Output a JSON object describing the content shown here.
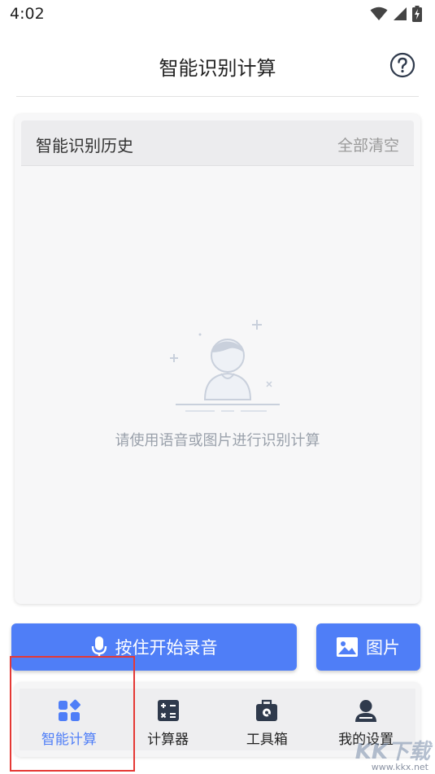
{
  "status_bar": {
    "time": "4:02",
    "icons": [
      "wifi-icon",
      "signal-icon",
      "battery-charging-icon"
    ]
  },
  "header": {
    "title": "智能识别计算",
    "help_icon": "help-circle-icon"
  },
  "history": {
    "title": "智能识别历史",
    "clear_label": "全部清空",
    "empty_text": "请使用语音或图片进行识别计算",
    "empty_icon": "empty-user-illustration"
  },
  "actions": {
    "voice_label": "按住开始录音",
    "voice_icon": "microphone-icon",
    "photo_label": "图片",
    "photo_icon": "image-icon"
  },
  "nav": {
    "items": [
      {
        "label": "智能计算",
        "icon": "smart-grid-icon",
        "active": true
      },
      {
        "label": "计算器",
        "icon": "calculator-icon",
        "active": false
      },
      {
        "label": "工具箱",
        "icon": "toolbox-icon",
        "active": false
      },
      {
        "label": "我的设置",
        "icon": "user-icon",
        "active": false
      }
    ]
  },
  "watermark": {
    "brand": "KK下载",
    "url": "www.kkx.net"
  },
  "colors": {
    "accent": "#4f7ef7",
    "highlight": "#e53935",
    "nav_icon": "#2f3a4c"
  }
}
